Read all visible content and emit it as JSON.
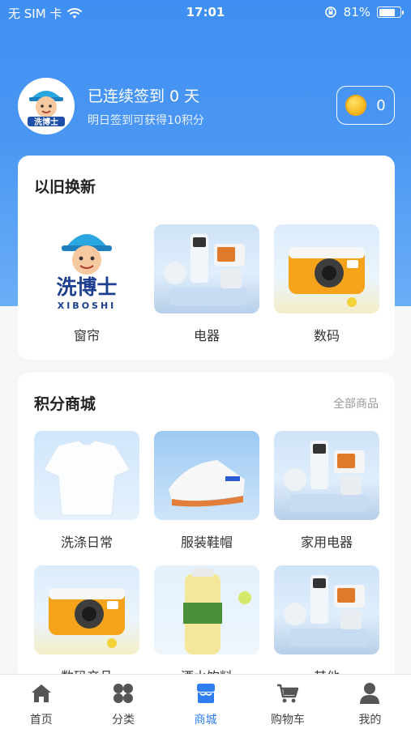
{
  "status_bar": {
    "carrier": "无 SIM 卡",
    "time": "17:01",
    "battery": "81%",
    "battery_level": 0.81
  },
  "profile": {
    "checkin_title": "已连续签到 0 天",
    "checkin_sub": "明日签到可获得10积分",
    "points": "0"
  },
  "trade_in": {
    "title": "以旧换新",
    "items": [
      {
        "label": "窗帘",
        "icon": "logo-image"
      },
      {
        "label": "电器",
        "icon": "appliance-image"
      },
      {
        "label": "数码",
        "icon": "camera-image"
      }
    ]
  },
  "mall": {
    "title": "积分商城",
    "all_link": "全部商品",
    "items": [
      {
        "label": "洗涤日常",
        "icon": "shirt-image"
      },
      {
        "label": "服装鞋帽",
        "icon": "shoes-image"
      },
      {
        "label": "家用电器",
        "icon": "appliance-image"
      },
      {
        "label": "数码产品",
        "icon": "camera-image"
      },
      {
        "label": "酒水饮料",
        "icon": "drink-image"
      },
      {
        "label": "其他",
        "icon": "appliance-image"
      }
    ]
  },
  "logo": {
    "text": "洗博士",
    "sub": "XIBOSHI"
  },
  "tabbar": {
    "active_color": "#2f7ef0",
    "items": [
      {
        "label": "首页",
        "icon": "home-icon"
      },
      {
        "label": "分类",
        "icon": "category-icon"
      },
      {
        "label": "商城",
        "icon": "mall-icon"
      },
      {
        "label": "购物车",
        "icon": "cart-icon"
      },
      {
        "label": "我的",
        "icon": "user-icon"
      }
    ]
  }
}
